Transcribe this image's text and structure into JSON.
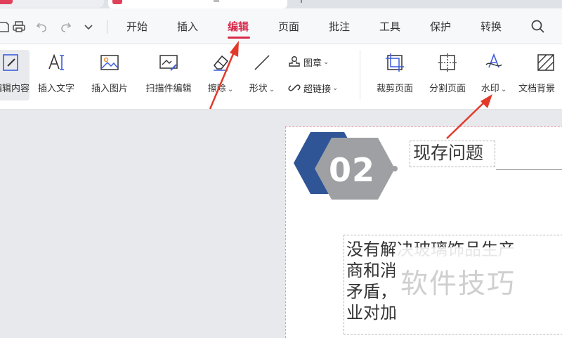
{
  "menu": {
    "tabs": [
      {
        "label": "开始"
      },
      {
        "label": "插入"
      },
      {
        "label": "编辑"
      },
      {
        "label": "页面"
      },
      {
        "label": "批注"
      },
      {
        "label": "工具"
      },
      {
        "label": "保护"
      },
      {
        "label": "转换"
      }
    ],
    "active_tab": "编辑"
  },
  "ribbon": {
    "edit_content": "编辑内容",
    "insert_text": "插入文字",
    "insert_image": "插入图片",
    "scan_edit": "扫描件编辑",
    "erase": "擦除",
    "shape": "形状",
    "stamp": "图章",
    "hyperlink": "超链接",
    "crop_page": "裁剪页面",
    "split_page": "分割页面",
    "watermark": "水印",
    "doc_background": "文档背景"
  },
  "document": {
    "section_number": "02",
    "section_title": "现存问题",
    "body_lines": [
      "没有解决玻璃饰品生产",
      "商和消",
      "矛盾，",
      "业对加"
    ],
    "watermark": "软件技巧"
  },
  "colors": {
    "accent": "#d92b4b",
    "arrow": "#e23a2a",
    "hex_blue": "#2f5597",
    "hex_gray": "#9ea0a3"
  }
}
